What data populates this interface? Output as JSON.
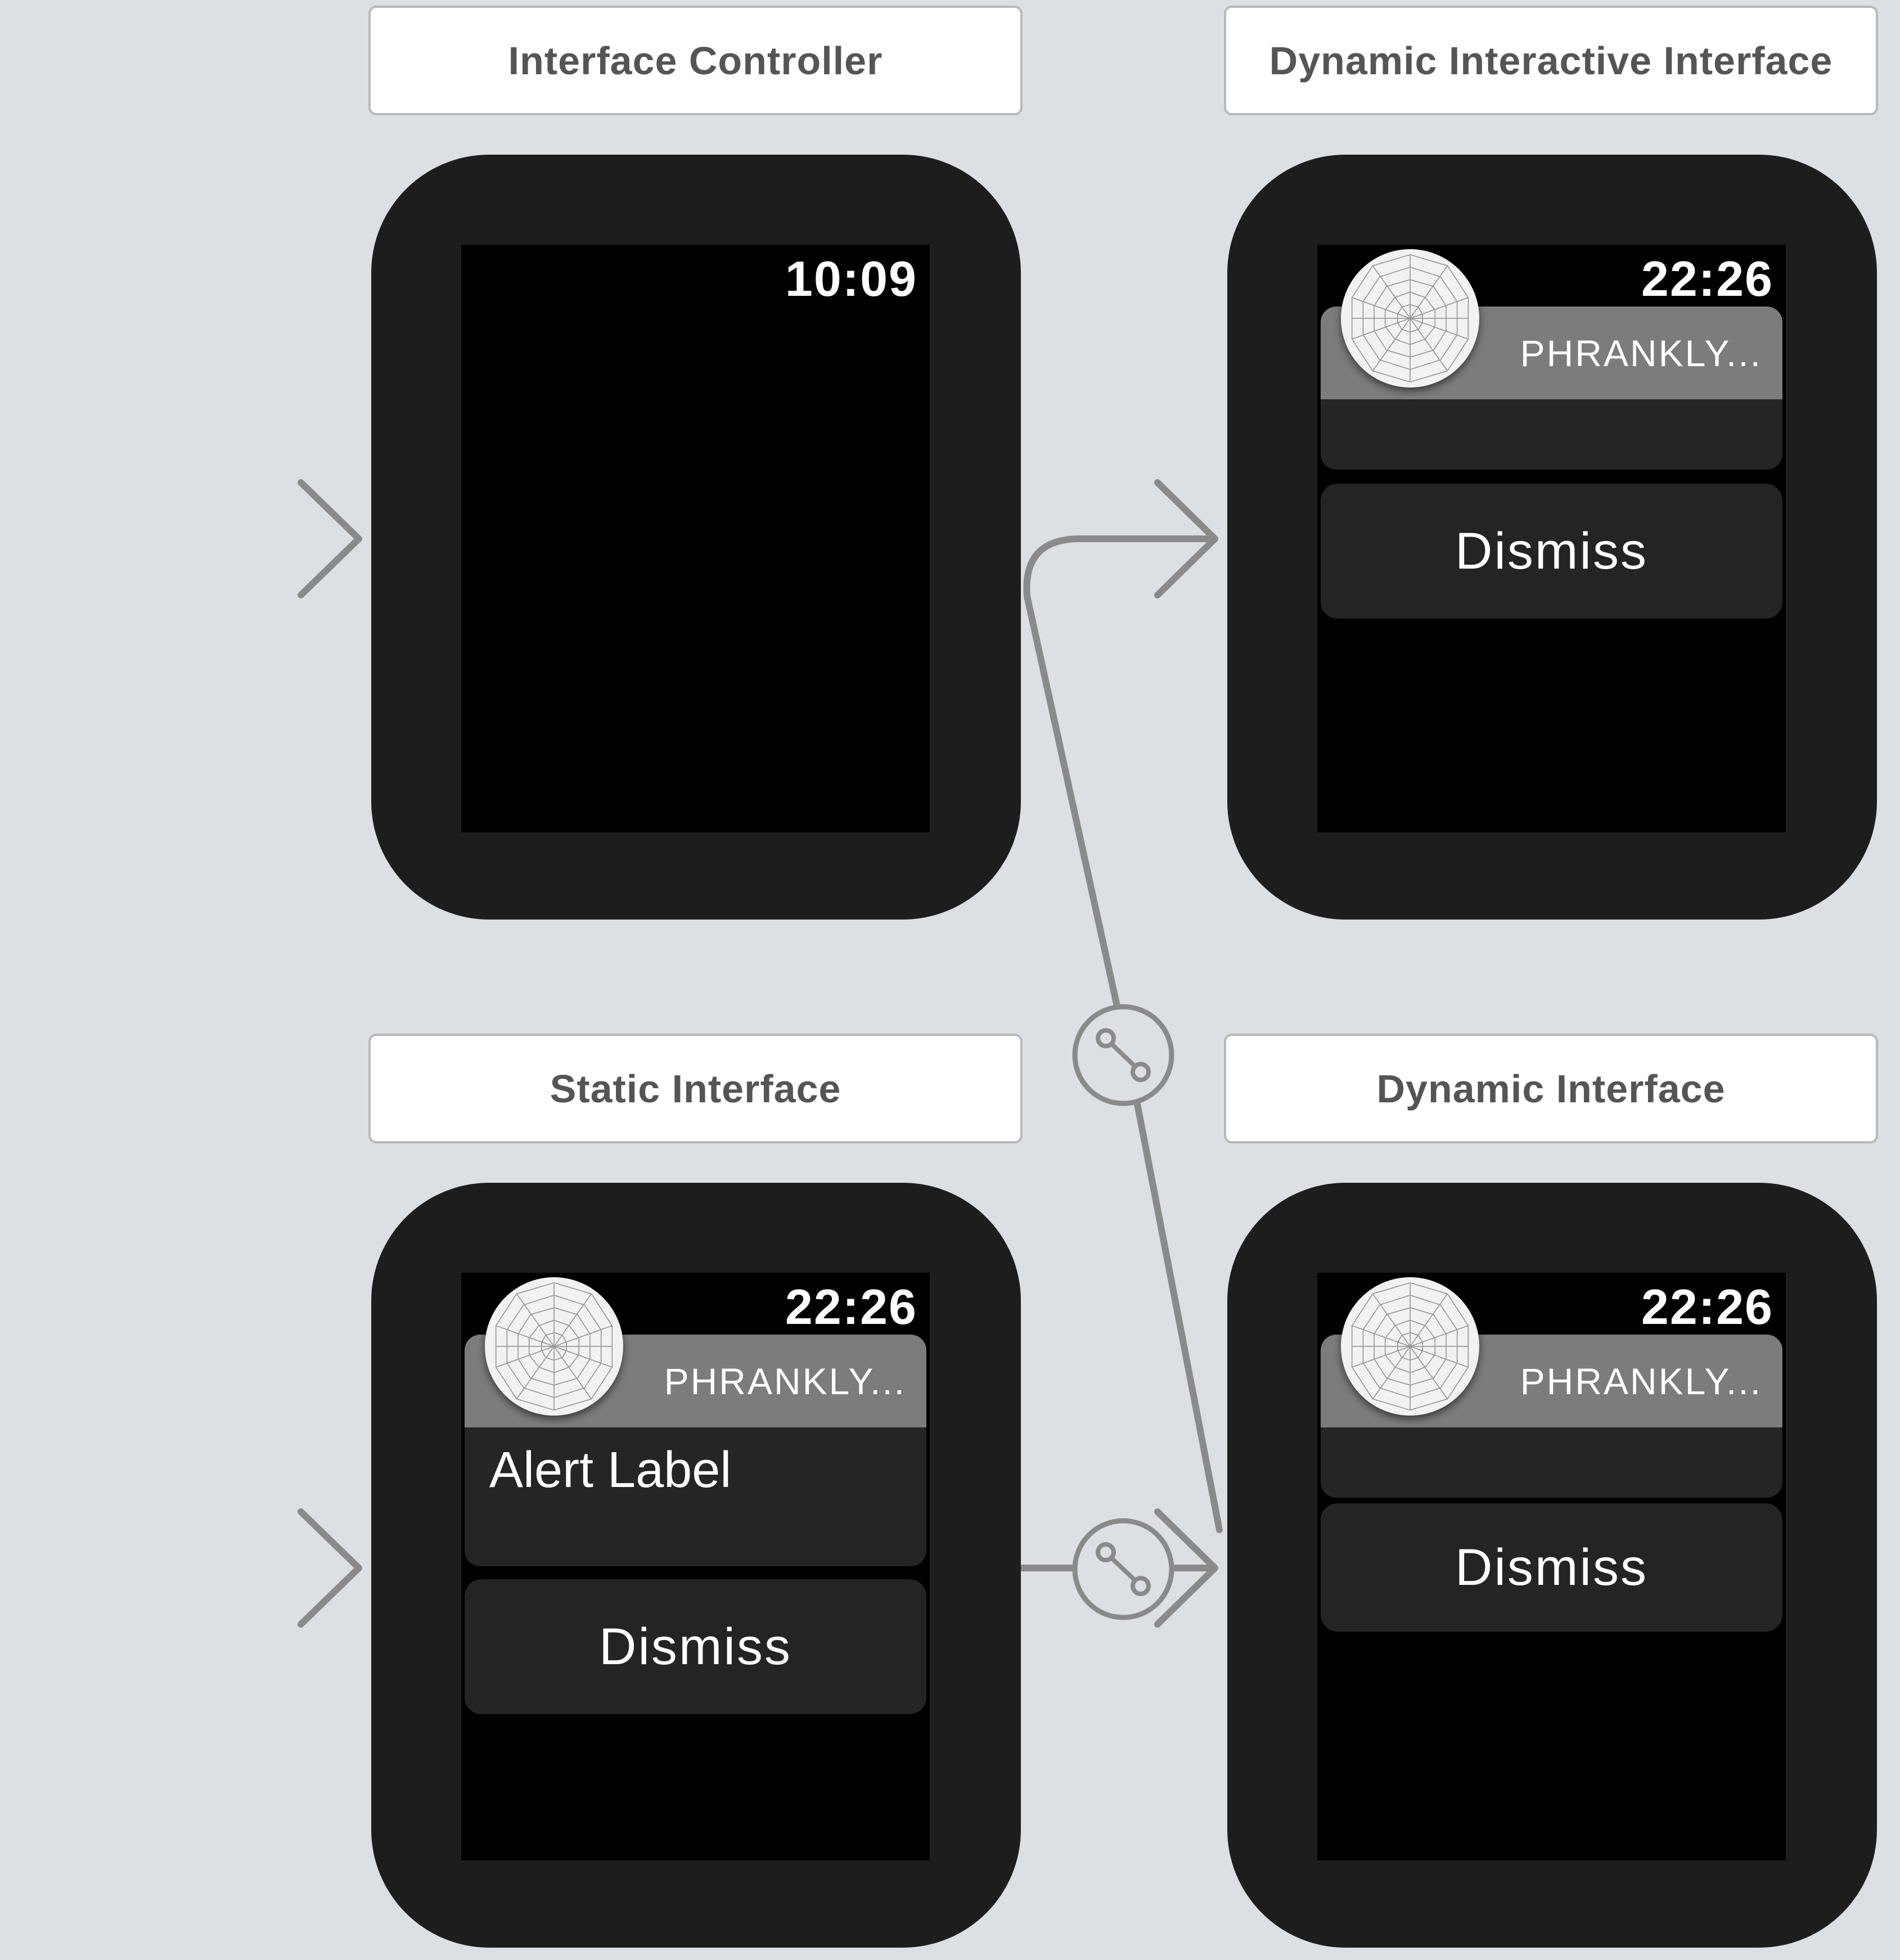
{
  "scenes": {
    "interface_controller": {
      "title": "Interface Controller",
      "time": "10:09"
    },
    "dynamic_interactive": {
      "title": "Dynamic Interactive Interface",
      "time": "22:26",
      "app_name": "PHRANKLY...",
      "dismiss": "Dismiss"
    },
    "static": {
      "title": "Static Interface",
      "time": "22:26",
      "app_name": "PHRANKLY...",
      "alert_label": "Alert Label",
      "dismiss": "Dismiss"
    },
    "dynamic": {
      "title": "Dynamic Interface",
      "time": "22:26",
      "app_name": "PHRANKLY...",
      "dismiss": "Dismiss"
    }
  },
  "icons": {
    "entry_arrow": "arrow-right-icon",
    "segue": "segue-link-icon",
    "app_icon": "radar-web-icon"
  },
  "colors": {
    "canvas": "#dcdfe4",
    "watch_body": "#1d1d1d",
    "connector": "#8a8a8a",
    "platter_header": "#7c7c7c",
    "platter": "#252525"
  }
}
